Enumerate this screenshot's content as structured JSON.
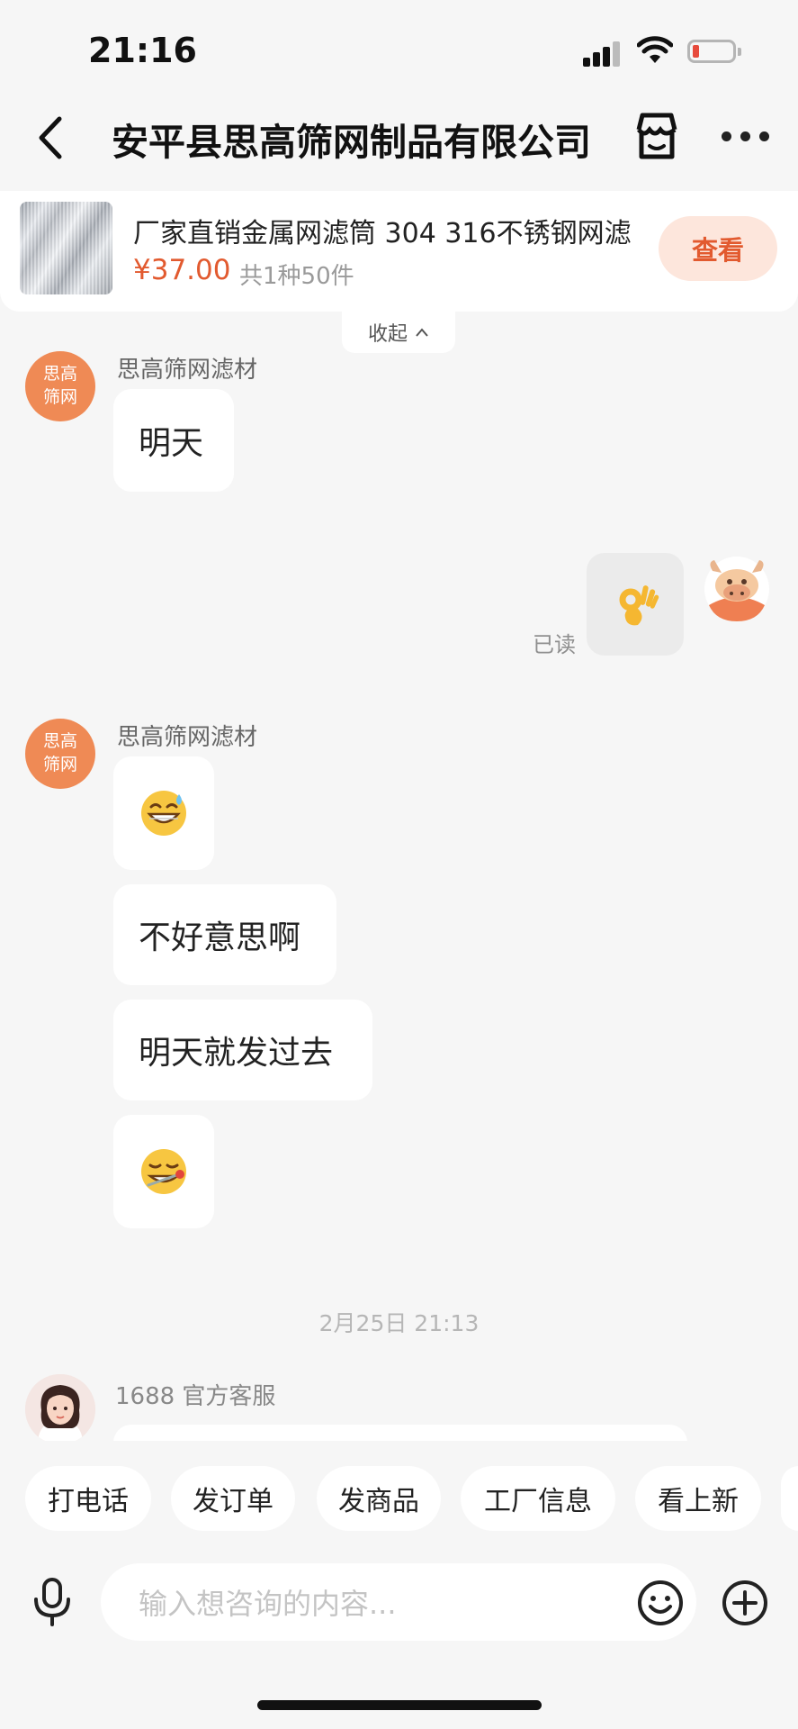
{
  "status_bar": {
    "time": "21:16",
    "battery_level": 0.12
  },
  "header": {
    "title": "安平县思高筛网制品有限公司",
    "icons": [
      "back-arrow-icon",
      "store-icon",
      "more-icon"
    ]
  },
  "product": {
    "title": "厂家直销金属网滤筒 304 316不锈钢网滤",
    "price": "¥37.00",
    "quantity": "共1种50件",
    "view_label": "查看",
    "collapse_label": "收起"
  },
  "messages": {
    "shop_avatar_line1": "思高",
    "shop_avatar_line2": "筛网",
    "sender_1": "思高筛网滤材",
    "msg_1": "明天",
    "my_emoji": "ok-hand-emoji",
    "read_label": "已读",
    "sender_2": "思高筛网滤材",
    "msg_2_emoji": "grinning-sweat-emoji",
    "msg_3": "不好意思啊",
    "msg_4": "明天就发过去",
    "msg_5_emoji": "thermometer-face-emoji",
    "timestamp": "2月25日 21:13",
    "cs_name": "1688 官方客服"
  },
  "quick_actions": [
    "打电话",
    "发订单",
    "发商品",
    "工厂信息",
    "看上新"
  ],
  "input": {
    "placeholder": "输入想咨询的内容..."
  },
  "colors": {
    "accent": "#e25a2f",
    "view_button_bg": "#fde6dc",
    "shop_avatar": "#ef8a55",
    "background": "#f6f6f6"
  }
}
